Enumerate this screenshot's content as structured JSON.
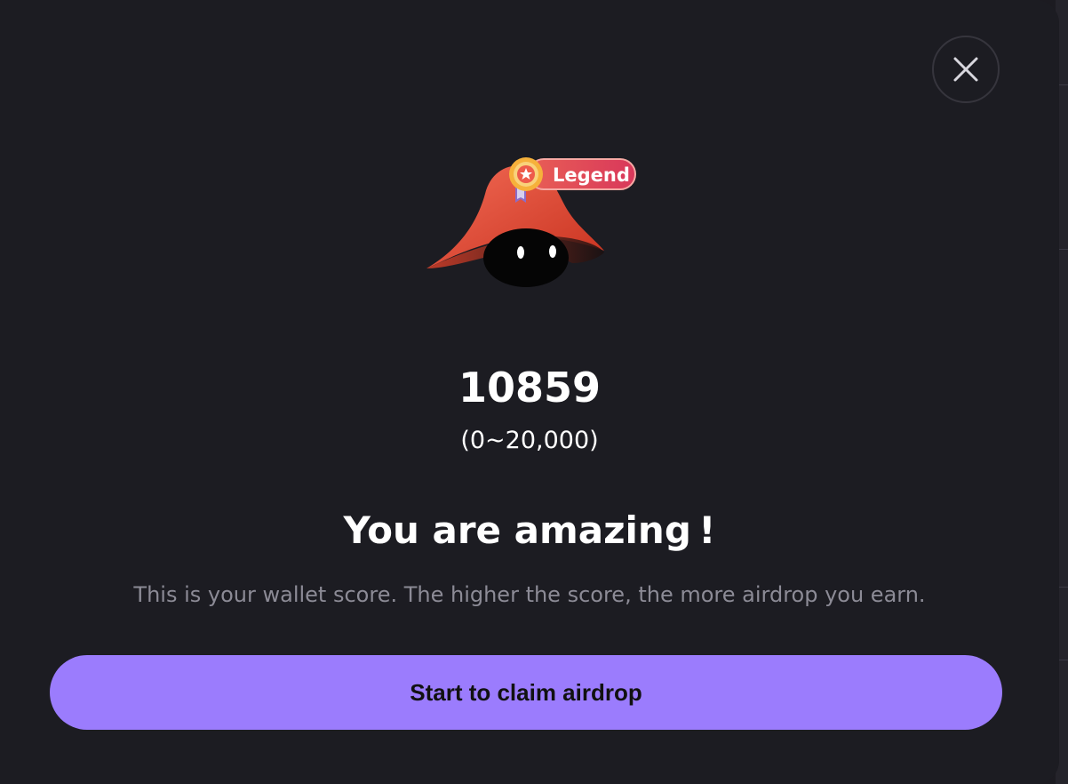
{
  "modal": {
    "close_icon": "close-icon",
    "mascot": {
      "icon": "wizard-hat-mascot",
      "hat_color": "#e8483a"
    },
    "badge": {
      "label": "Legend",
      "icon": "medal-icon"
    },
    "score": {
      "value": "10859",
      "range": "(0~20,000)"
    },
    "headline": "You are amazing !",
    "description": "This is your wallet score. The higher the score, the more airdrop you earn.",
    "cta_label": "Start to claim airdrop"
  },
  "colors": {
    "background": "#1c1c22",
    "accent": "#9b7cfd",
    "badge": "#e04a57",
    "muted_text": "#8c8b96"
  }
}
